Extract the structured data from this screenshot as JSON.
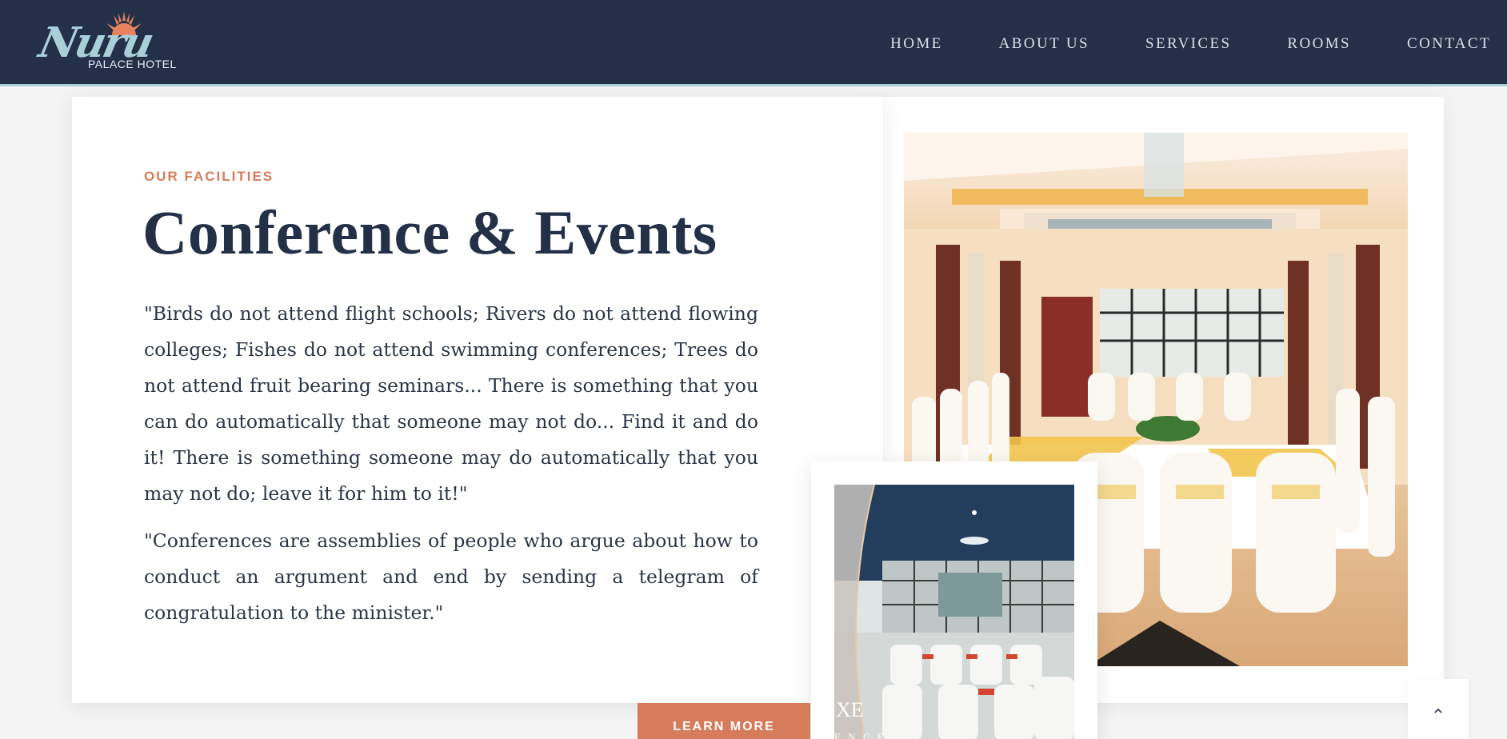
{
  "brand": {
    "logo_script": "Nuru",
    "logo_sub": "PALACE HOTEL"
  },
  "nav": {
    "items": [
      {
        "label": "HOME"
      },
      {
        "label": "ABOUT US"
      },
      {
        "label": "SERVICES"
      },
      {
        "label": "ROOMS"
      },
      {
        "label": "CONTACT"
      }
    ]
  },
  "main": {
    "eyebrow": "OUR FACILITIES",
    "title": "Conference & Events",
    "paragraph1": "\"Birds do not attend flight schools; Rivers do not attend flowing colleges; Fishes do not attend swimming conferences; Trees do not attend fruit bearing seminars... There is something that you can do automatically that someone may not do... Find it and do it! There is something someone may do automatically that you may not do; leave it for him to it!\"",
    "paragraph2": "\"Conferences are assemblies of people who argue about how to conduct an argument and end by sending a telegram of congratulation to the minister.\"",
    "learn_more": "LEARN MORE"
  },
  "images": {
    "small_caption_1": "XE",
    "small_caption_2": "E N C E"
  },
  "icons": {
    "logo_sun": "sun-icon",
    "scroll_top": "chevron-up-icon"
  },
  "colors": {
    "header_bg": "#233048",
    "accent": "#d77c5b",
    "logo_blue": "#a9cfd8",
    "text_dark": "#233048"
  }
}
